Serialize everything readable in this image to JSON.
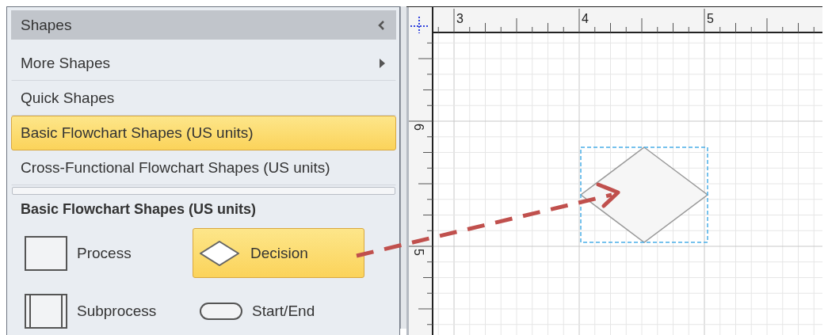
{
  "shapes_panel": {
    "title": "Shapes",
    "menu_items": [
      {
        "label": "More Shapes",
        "kind": "submenu",
        "selected": false
      },
      {
        "label": "Quick Shapes",
        "kind": "stencil",
        "selected": false
      },
      {
        "label": "Basic Flowchart Shapes (US units)",
        "kind": "stencil",
        "selected": true
      },
      {
        "label": "Cross-Functional Flowchart Shapes (US units)",
        "kind": "stencil",
        "selected": false
      }
    ],
    "stencil_title": "Basic Flowchart Shapes (US units)",
    "stencil_shapes": [
      {
        "label": "Process",
        "kind": "process",
        "selected": false
      },
      {
        "label": "Decision",
        "kind": "decision",
        "selected": true
      },
      {
        "label": "Subprocess",
        "kind": "subprocess",
        "selected": false
      },
      {
        "label": "Start/End",
        "kind": "terminator",
        "selected": false
      }
    ]
  },
  "canvas": {
    "top_ruler_labels": [
      "3",
      "4",
      "5"
    ],
    "left_ruler_labels": [
      "6",
      "5"
    ],
    "shapes": [
      {
        "kind": "decision",
        "selected": true
      }
    ]
  }
}
